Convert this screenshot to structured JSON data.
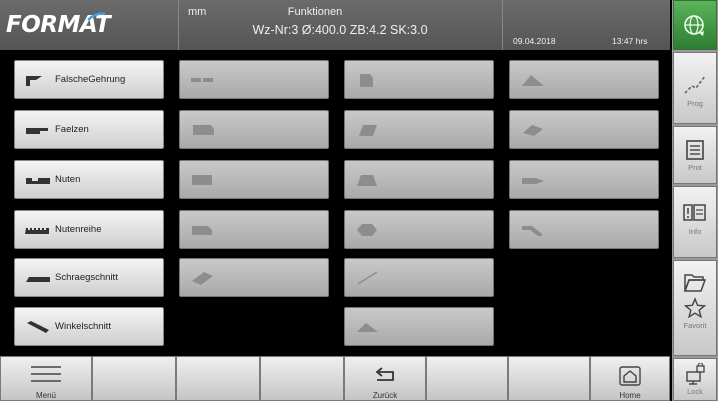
{
  "header": {
    "logo": "FORMAT",
    "unit": "mm",
    "title": "Funktionen",
    "tool_info": "Wz-Nr:3 Ø:400.0 ZB:4.2 SK:3.0",
    "date": "09.04.2018",
    "time": "13:47 hrs"
  },
  "functions": {
    "col1": [
      {
        "label": "FalscheGehrung",
        "icon": "false-miter-icon"
      },
      {
        "label": "Faelzen",
        "icon": "rebate-icon"
      },
      {
        "label": "Nuten",
        "icon": "groove-icon"
      },
      {
        "label": "Nutenreihe",
        "icon": "groove-row-icon"
      },
      {
        "label": "Schraegschnitt",
        "icon": "bevel-cut-icon"
      },
      {
        "label": "Winkelschnitt",
        "icon": "angle-cut-icon"
      }
    ]
  },
  "sidebar": {
    "prog": "Prog",
    "prot": "Prot",
    "info": "Info",
    "favorit": "Favorit",
    "lock": "Lock"
  },
  "footer": {
    "menu": "Menü",
    "back": "Zurück",
    "home": "Home"
  },
  "colors": {
    "header_bg": "#5f5f5f",
    "button_enabled": "#e6e6e6",
    "button_disabled": "#b5b5b5",
    "globe_green": "#3f9a40"
  }
}
